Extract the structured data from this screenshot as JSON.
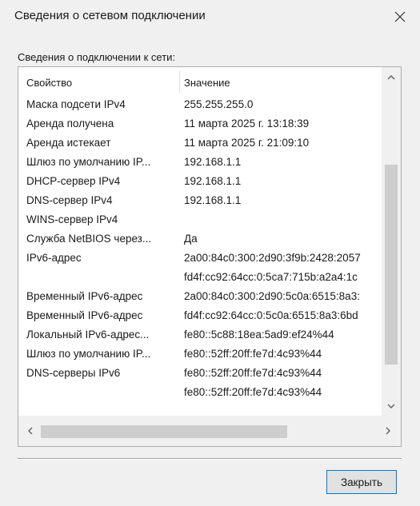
{
  "window": {
    "title": "Сведения о сетевом подключении",
    "close_icon": "close-icon"
  },
  "group_label": "Сведения о подключении к сети:",
  "table": {
    "headers": [
      "Свойство",
      "Значение"
    ],
    "rows": [
      {
        "prop": "Маска подсети IPv4",
        "val": "255.255.255.0"
      },
      {
        "prop": "Аренда получена",
        "val": "11 марта 2025 г. 13:18:39"
      },
      {
        "prop": "Аренда истекает",
        "val": "11 марта 2025 г. 21:09:10"
      },
      {
        "prop": "Шлюз по умолчанию IP...",
        "val": "192.168.1.1"
      },
      {
        "prop": "DHCP-сервер IPv4",
        "val": "192.168.1.1"
      },
      {
        "prop": "DNS-сервер IPv4",
        "val": "192.168.1.1"
      },
      {
        "prop": "WINS-сервер IPv4",
        "val": ""
      },
      {
        "prop": "Служба NetBIOS через...",
        "val": "Да"
      },
      {
        "prop": "IPv6-адрес",
        "val": "2a00:84c0:300:2d90:3f9b:2428:2057"
      },
      {
        "prop": "",
        "val": "fd4f:cc92:64cc:0:5ca7:715b:a2a4:1c"
      },
      {
        "prop": "Временный IPv6-адрес",
        "val": "2a00:84c0:300:2d90:5c0a:6515:8a3:"
      },
      {
        "prop": "Временный IPv6-адрес",
        "val": "fd4f:cc92:64cc:0:5c0a:6515:8a3:6bd"
      },
      {
        "prop": "Локальный IPv6-адрес...",
        "val": "fe80::5c88:18ea:5ad9:ef24%44"
      },
      {
        "prop": "Шлюз по умолчанию IP...",
        "val": "fe80::52ff:20ff:fe7d:4c93%44"
      },
      {
        "prop": "DNS-серверы IPv6",
        "val": "fe80::52ff:20ff:fe7d:4c93%44"
      },
      {
        "prop": "",
        "val": "fe80::52ff:20ff:fe7d:4c93%44"
      }
    ]
  },
  "scrollbars": {
    "up_icon": "chevron-up-icon",
    "down_icon": "chevron-down-icon",
    "left_icon": "chevron-left-icon",
    "right_icon": "chevron-right-icon"
  },
  "buttons": {
    "close_label": "Закрыть"
  },
  "colors": {
    "window_bg": "#f0f0f0",
    "list_bg": "#ffffff",
    "scrollbar_thumb": "#cdcdcd",
    "focus_border": "#0078d7"
  }
}
